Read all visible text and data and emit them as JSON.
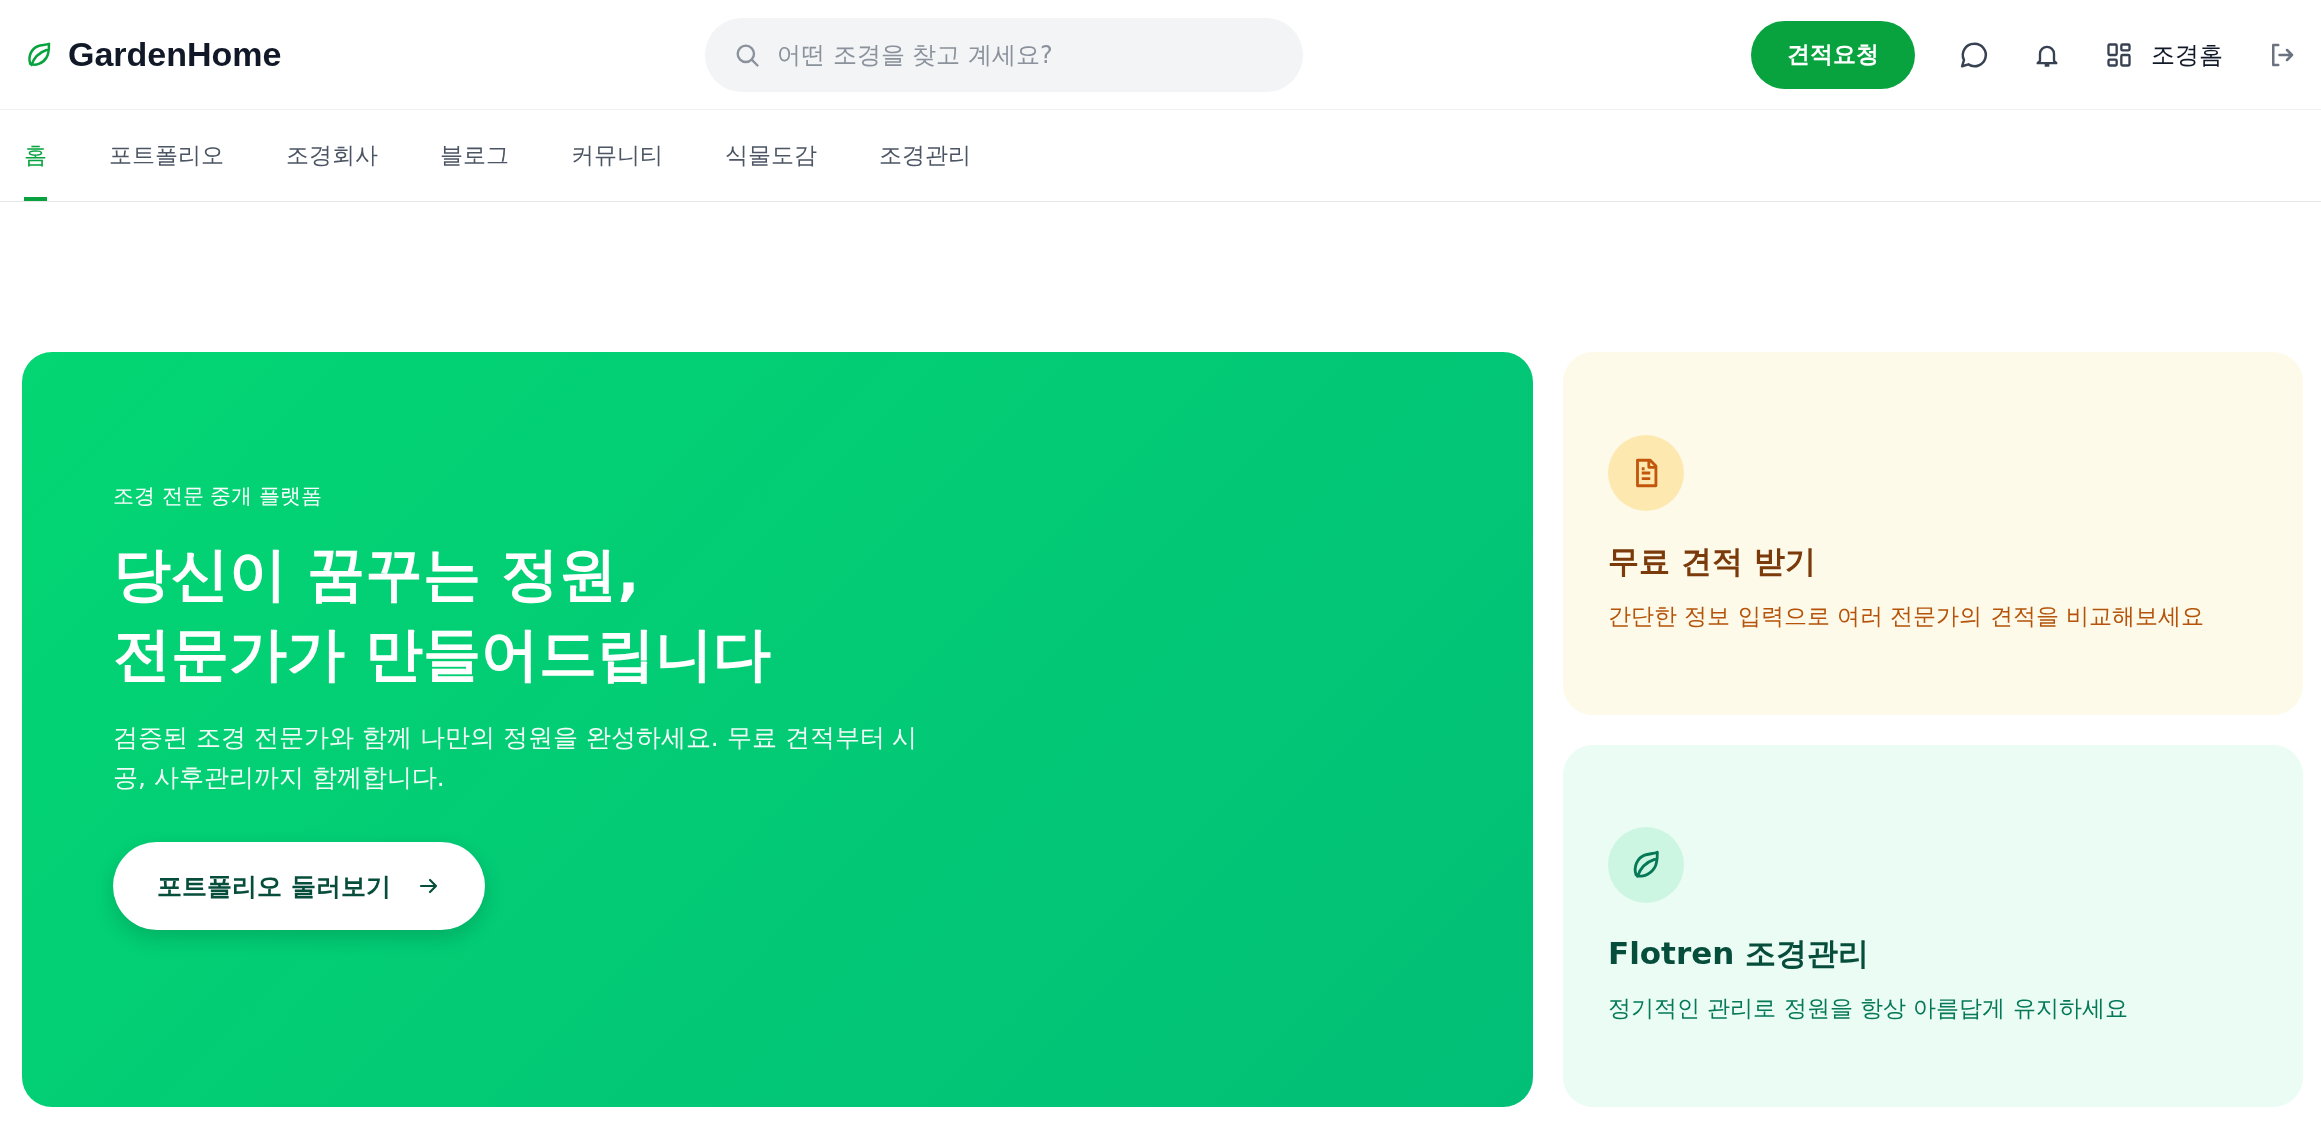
{
  "header": {
    "logo": "GardenHome",
    "search": {
      "placeholder": "어떤 조경을 찾고 계세요?"
    },
    "cta": "견적요청",
    "user": "조경홈"
  },
  "nav": [
    {
      "label": "홈",
      "selected": true
    },
    {
      "label": "포트폴리오",
      "selected": false
    },
    {
      "label": "조경회사",
      "selected": false
    },
    {
      "label": "블로그",
      "selected": false
    },
    {
      "label": "커뮤니티",
      "selected": false
    },
    {
      "label": "식물도감",
      "selected": false
    },
    {
      "label": "조경관리",
      "selected": false
    }
  ],
  "hero": {
    "eyebrow": "조경 전문 중개 플랫폼",
    "headline": [
      "당신이 꿈꾸는 정원,",
      "전문가가 만들어드립니다"
    ],
    "text": "검증된 조경 전문가와 함께 나만의 정원을 완성하세요. 무료 견적부터 시공, 사후관리까지 함께합니다.",
    "button": "포트폴리오 둘러보기"
  },
  "cards": [
    {
      "kind": "quote",
      "title": "무료 견적 받기",
      "text": "간단한 정보 입력으로 여러 전문가의 견적을 비교해보세요"
    },
    {
      "kind": "care",
      "title": "Flotren 조경관리",
      "text": "정기적인 관리로 정원을 항상 아름답게 유지하세요"
    }
  ]
}
